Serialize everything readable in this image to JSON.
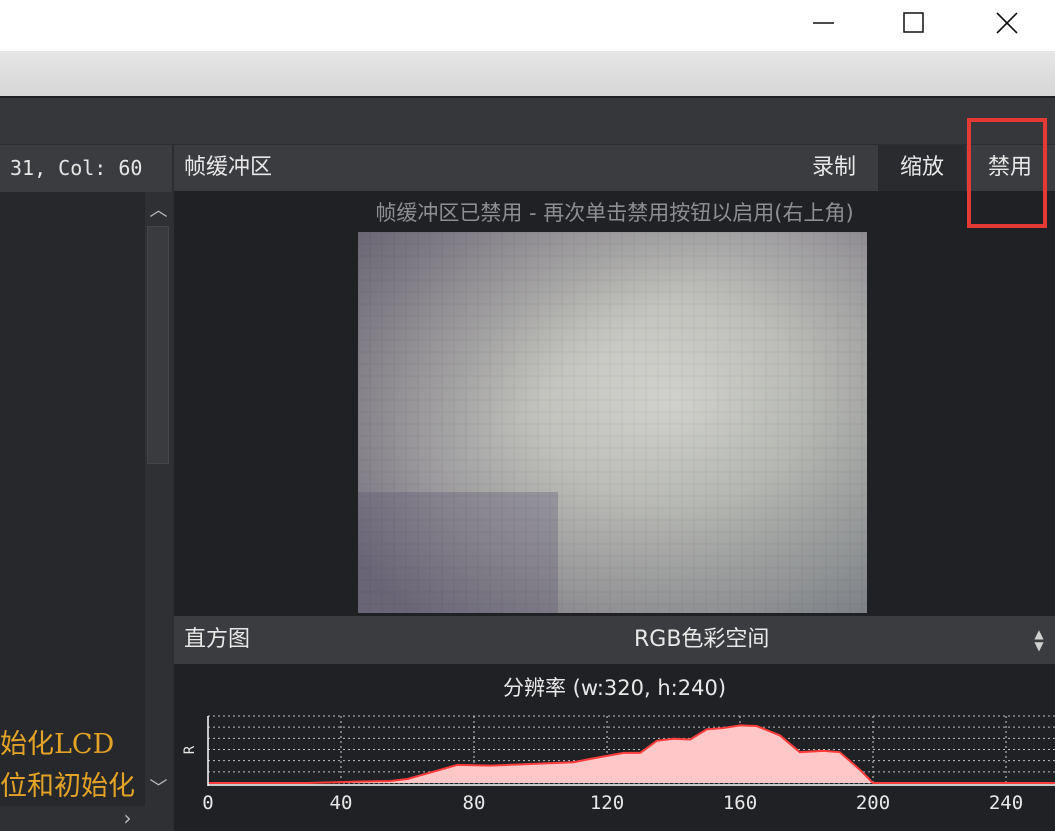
{
  "window": {
    "minimize_glyph": "—",
    "maximize_glyph": "☐",
    "close_glyph": "✕"
  },
  "editor": {
    "status": "31, Col: 60",
    "lines": [
      "始化LCD",
      "位和初始化"
    ],
    "text_color": "#e3a326"
  },
  "frame_buffer": {
    "title": "帧缓冲区",
    "record_label": "录制",
    "zoom_label": "缩放",
    "disable_label": "禁用",
    "message": "帧缓冲区已禁用 - 再次单击禁用按钮以启用(右上角)",
    "highlight_color": "#e53935"
  },
  "histogram": {
    "title": "直方图",
    "color_space": "RGB色彩空间",
    "resolution": "分辨率 (w:320, h:240)",
    "channel_label": "R",
    "fill_color": "#ffc7c7",
    "line_color": "#ff3b3b"
  },
  "chart_data": {
    "type": "area",
    "xlabel": "",
    "ylabel": "R",
    "xlim": [
      0,
      255
    ],
    "x_ticks": [
      "0",
      "40",
      "80",
      "120",
      "160",
      "200",
      "240"
    ],
    "x": [
      0,
      30,
      45,
      55,
      60,
      65,
      75,
      85,
      95,
      110,
      115,
      125,
      130,
      135,
      140,
      145,
      150,
      155,
      160,
      165,
      172,
      178,
      185,
      190,
      196,
      200,
      255
    ],
    "values": [
      0,
      0,
      0.02,
      0.03,
      0.06,
      0.13,
      0.27,
      0.26,
      0.28,
      0.31,
      0.36,
      0.45,
      0.45,
      0.63,
      0.66,
      0.65,
      0.8,
      0.82,
      0.86,
      0.85,
      0.71,
      0.46,
      0.48,
      0.46,
      0.2,
      0,
      0
    ],
    "grid": true
  }
}
